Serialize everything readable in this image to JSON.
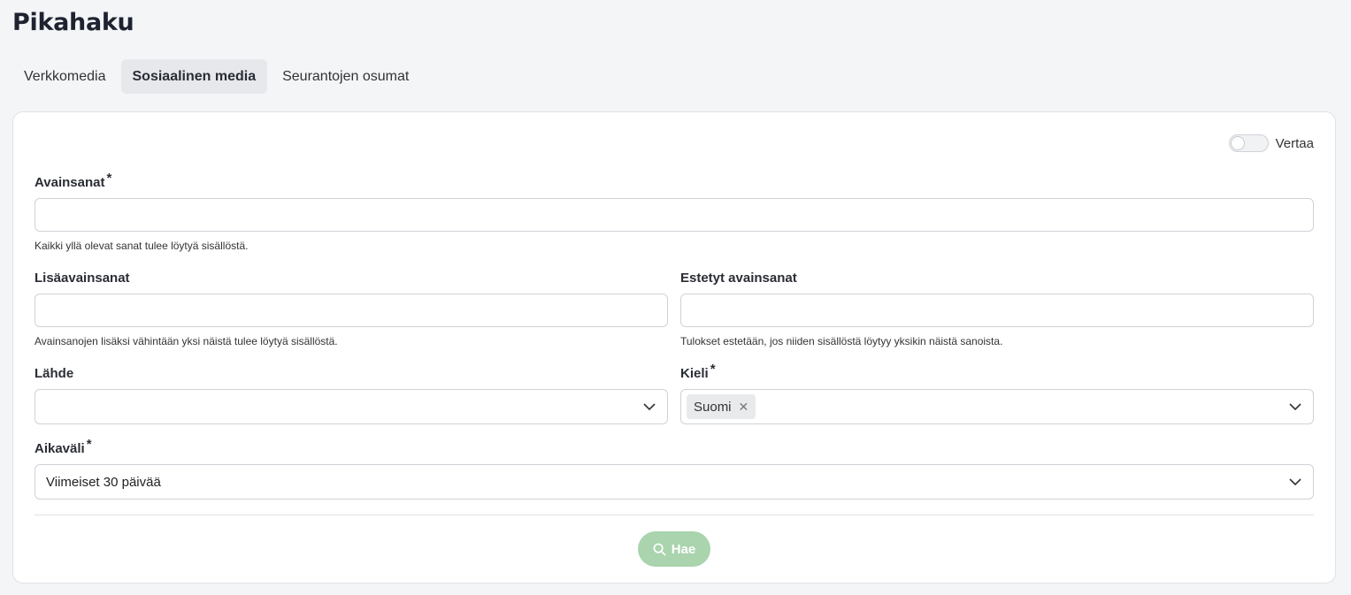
{
  "page": {
    "title": "Pikahaku"
  },
  "tabs": [
    {
      "label": "Verkkomedia",
      "active": false
    },
    {
      "label": "Sosiaalinen media",
      "active": true
    },
    {
      "label": "Seurantojen osumat",
      "active": false
    }
  ],
  "compare": {
    "label": "Vertaa",
    "on": false
  },
  "keywords": {
    "label": "Avainsanat",
    "required_mark": "*",
    "value": "",
    "hint": "Kaikki yllä olevat sanat tulee löytyä sisällöstä."
  },
  "extra_keywords": {
    "label": "Lisäavainsanat",
    "value": "",
    "hint": "Avainsanojen lisäksi vähintään yksi näistä tulee löytyä sisällöstä."
  },
  "blocked_keywords": {
    "label": "Estetyt avainsanat",
    "value": "",
    "hint": "Tulokset estetään, jos niiden sisällöstä löytyy yksikin näistä sanoista."
  },
  "source": {
    "label": "Lähde",
    "value": ""
  },
  "language": {
    "label": "Kieli",
    "required_mark": "*",
    "chips": [
      "Suomi"
    ]
  },
  "timerange": {
    "label": "Aikaväli",
    "required_mark": "*",
    "value": "Viimeiset 30 päivää"
  },
  "search_button": {
    "label": "Hae"
  },
  "colors": {
    "accent_disabled": "#a9d4ad",
    "background": "#f4f5f7"
  },
  "icons": {
    "search": "search-icon",
    "chevron": "chevron-down-icon",
    "remove": "close-icon"
  }
}
